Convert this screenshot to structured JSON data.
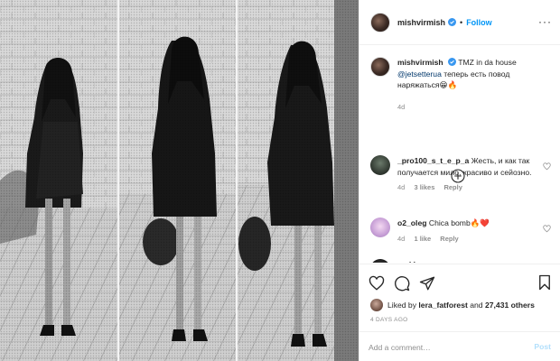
{
  "post": {
    "username": "mishvirmish",
    "follow_label": "Follow",
    "caption_text": "TMZ in da house",
    "caption_tag": "@jetsetterua",
    "caption_rest": "теперь есть повод наряжаться😁🔥",
    "caption_time": "4d",
    "likes_prefix": "Liked by",
    "likes_user": "lera_fatforest",
    "likes_and": "and",
    "likes_count": "27,431 others",
    "posted_ago": "4 DAYS AGO",
    "add_comment_placeholder": "Add a comment…",
    "post_label": "Post"
  },
  "comments": [
    {
      "user": "_pro100_s_t_e_p_a",
      "text": "Жесть, и как так получается мило, красиво и сейозно.",
      "time": "4d",
      "likes": "3 likes",
      "reply": "Reply"
    },
    {
      "user": "o2_oleg",
      "text": "Chica bomb🔥❤️",
      "time": "4d",
      "likes": "1 like",
      "reply": "Reply"
    },
    {
      "user": "reckky",
      "text": "",
      "time": "",
      "likes": "",
      "reply": ""
    }
  ],
  "icons": {
    "verified": "verified-badge-icon",
    "more": "more-options-icon",
    "load_more": "plus-circle-icon",
    "like": "heart-icon",
    "comment": "comment-icon",
    "share": "paper-plane-icon",
    "save": "bookmark-icon"
  },
  "colors": {
    "accent": "#0095f6",
    "muted": "#8e8e8e",
    "link": "#00376b",
    "post_disabled": "#b2dffc"
  }
}
